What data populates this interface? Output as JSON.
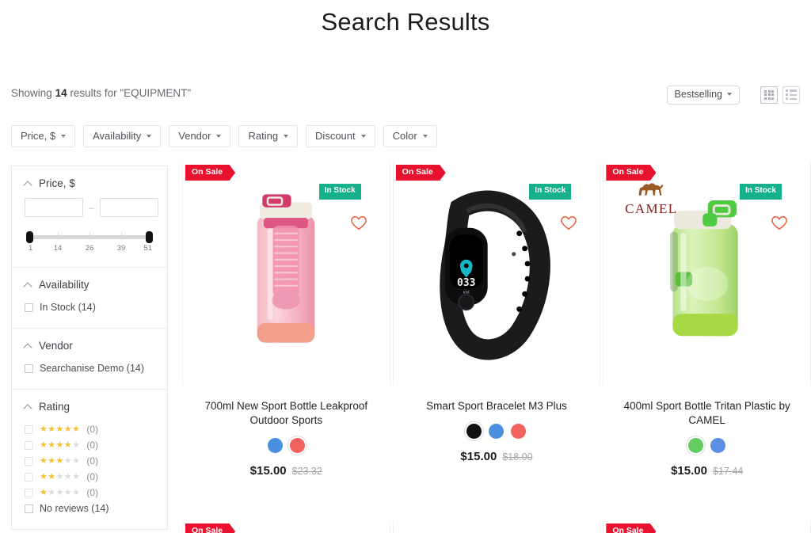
{
  "header": {
    "title": "Search Results"
  },
  "results_bar": {
    "showing_prefix": "Showing",
    "count": "14",
    "showing_suffix": "results for \"EQUIPMENT\"",
    "sort_label": "Bestselling",
    "grid_view_icon": "grid-view-icon",
    "list_view_icon": "list-view-icon"
  },
  "filter_chips": [
    {
      "label": "Price, $"
    },
    {
      "label": "Availability"
    },
    {
      "label": "Vendor"
    },
    {
      "label": "Rating"
    },
    {
      "label": "Discount"
    },
    {
      "label": "Color"
    }
  ],
  "sidebar": {
    "price": {
      "title": "Price, $",
      "min_placeholder": "",
      "max_placeholder": "",
      "min_value": "",
      "max_value": "",
      "separator": "–",
      "ticks": [
        "1",
        "14",
        "26",
        "39",
        "51"
      ],
      "range_min": 1,
      "range_max": 51
    },
    "availability": {
      "title": "Availability",
      "options": [
        {
          "label": "In Stock (14)",
          "checked": false,
          "disabled": false
        }
      ]
    },
    "vendor": {
      "title": "Vendor",
      "options": [
        {
          "label": "Searchanise Demo (14)",
          "checked": false,
          "disabled": false
        }
      ]
    },
    "rating": {
      "title": "Rating",
      "options": [
        {
          "stars": 5,
          "count": "(0)",
          "disabled": true
        },
        {
          "stars": 4,
          "count": "(0)",
          "disabled": true
        },
        {
          "stars": 3,
          "count": "(0)",
          "disabled": true
        },
        {
          "stars": 2,
          "count": "(0)",
          "disabled": true
        },
        {
          "stars": 1,
          "count": "(0)",
          "disabled": true
        }
      ],
      "no_reviews_label": "No reviews (14)"
    }
  },
  "products": [
    {
      "sale_badge": "On Sale",
      "stock_badge": "In Stock",
      "title": "700ml New Sport Bottle Leakproof Outdoor Sports",
      "price": "$15.00",
      "old_price": "$23.32",
      "brand_logo": null,
      "image_kind": "pink-water-bottle",
      "swatches": [
        {
          "color": "#4a8fe0",
          "selected": false
        },
        {
          "color": "#f2625e",
          "selected": true
        }
      ]
    },
    {
      "sale_badge": "On Sale",
      "stock_badge": "In Stock",
      "title": "Smart Sport Bracelet M3 Plus",
      "price": "$15.00",
      "old_price": "$18.00",
      "brand_logo": null,
      "image_kind": "black-fitness-band",
      "swatches": [
        {
          "color": "#111111",
          "selected": true
        },
        {
          "color": "#4a8fe0",
          "selected": false
        },
        {
          "color": "#f2625e",
          "selected": false
        }
      ]
    },
    {
      "sale_badge": "On Sale",
      "stock_badge": "In Stock",
      "title": "400ml Sport Bottle Tritan Plastic by CAMEL",
      "price": "$15.00",
      "old_price": "$17.44",
      "brand_logo": {
        "name": "CAMEL",
        "icon": "camel-icon"
      },
      "image_kind": "green-water-bottle",
      "swatches": [
        {
          "color": "#63cc63",
          "selected": true
        },
        {
          "color": "#5b8fe3",
          "selected": false
        }
      ]
    }
  ],
  "products_row2": [
    {
      "sale_badge": "On Sale"
    },
    {
      "sale_badge": ""
    },
    {
      "sale_badge": "On Sale"
    }
  ],
  "colors": {
    "sale_red": "#e8122e",
    "stock_green": "#16b08a",
    "wishlist_orange": "#e8613f",
    "star_gold": "#f5c133"
  }
}
